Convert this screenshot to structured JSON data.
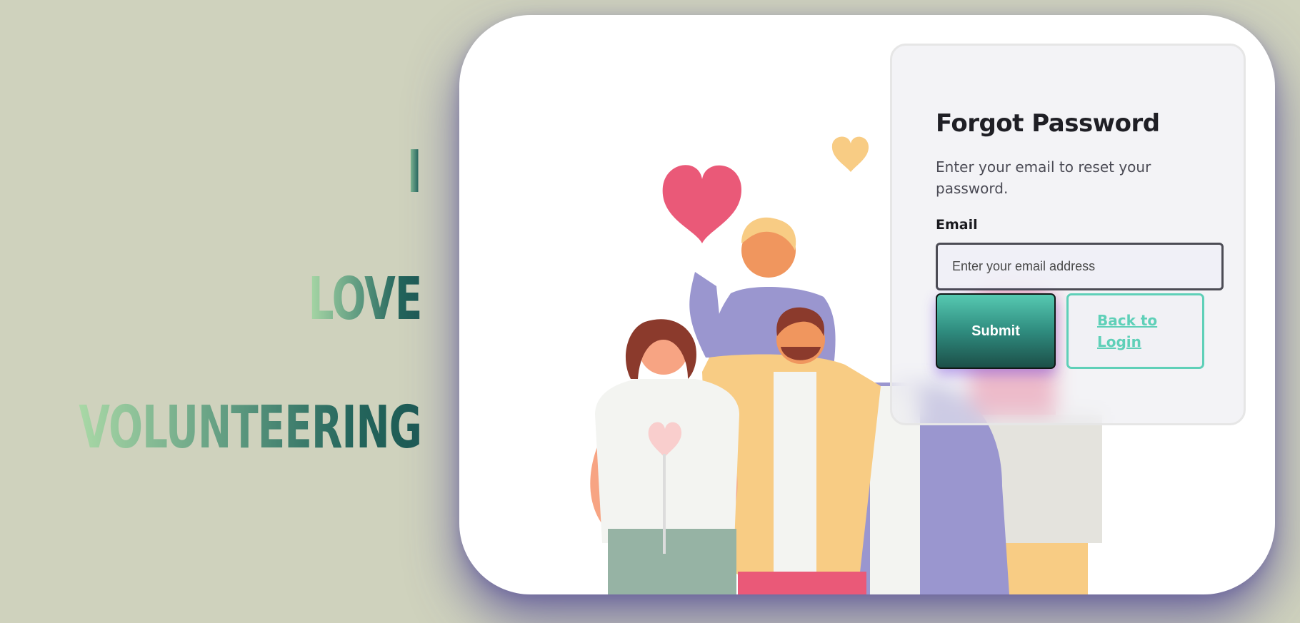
{
  "slogan": {
    "word1": "I",
    "word2": "LOVE",
    "word3": "VOLUNTEERING"
  },
  "form": {
    "title": "Forgot Password",
    "description": "Enter your email to reset your password.",
    "email_label": "Email",
    "email_placeholder": "Enter your email address",
    "email_value": "",
    "submit_label": "Submit",
    "back_label": "Back to Login"
  },
  "colors": {
    "page_background": "#cfd2bd",
    "accent_teal": "#5fd0b8",
    "button_dark": "#1c4f48",
    "card_shadow": "#564e96"
  },
  "illustration": {
    "description_icon": "volunteers-illustration"
  }
}
